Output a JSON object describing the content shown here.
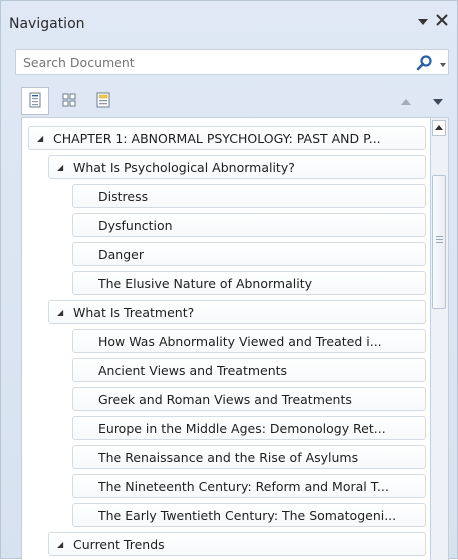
{
  "pane": {
    "title": "Navigation",
    "search_placeholder": "Search Document"
  },
  "view_tabs": [
    {
      "name": "headings",
      "icon": "headings-icon",
      "selected": true
    },
    {
      "name": "pages",
      "icon": "page-thumbnails-icon",
      "selected": false
    },
    {
      "name": "results",
      "icon": "search-results-icon",
      "selected": false
    }
  ],
  "tree": {
    "chapter": {
      "label": "CHAPTER 1: ABNORMAL PSYCHOLOGY: PAST AND P...",
      "expanded": true
    },
    "section1": {
      "label": "What Is Psychological Abnormality?",
      "expanded": true,
      "children": [
        "Distress",
        "Dysfunction",
        "Danger",
        "The Elusive Nature of Abnormality"
      ]
    },
    "section2": {
      "label": "What Is Treatment?",
      "expanded": true,
      "children": [
        "How Was Abnormality Viewed and Treated i...",
        "Ancient Views and Treatments",
        "Greek and Roman Views and Treatments",
        "Europe in the Middle Ages: Demonology Ret...",
        "The Renaissance and the Rise of Asylums",
        "The Nineteenth Century: Reform and Moral T...",
        "The Early Twentieth Century: The Somatogeni..."
      ]
    },
    "section3": {
      "label": "Current Trends",
      "expanded": true
    }
  },
  "colors": {
    "pane_bg": "#dfe8f4",
    "accent": "#2b5fa8"
  }
}
